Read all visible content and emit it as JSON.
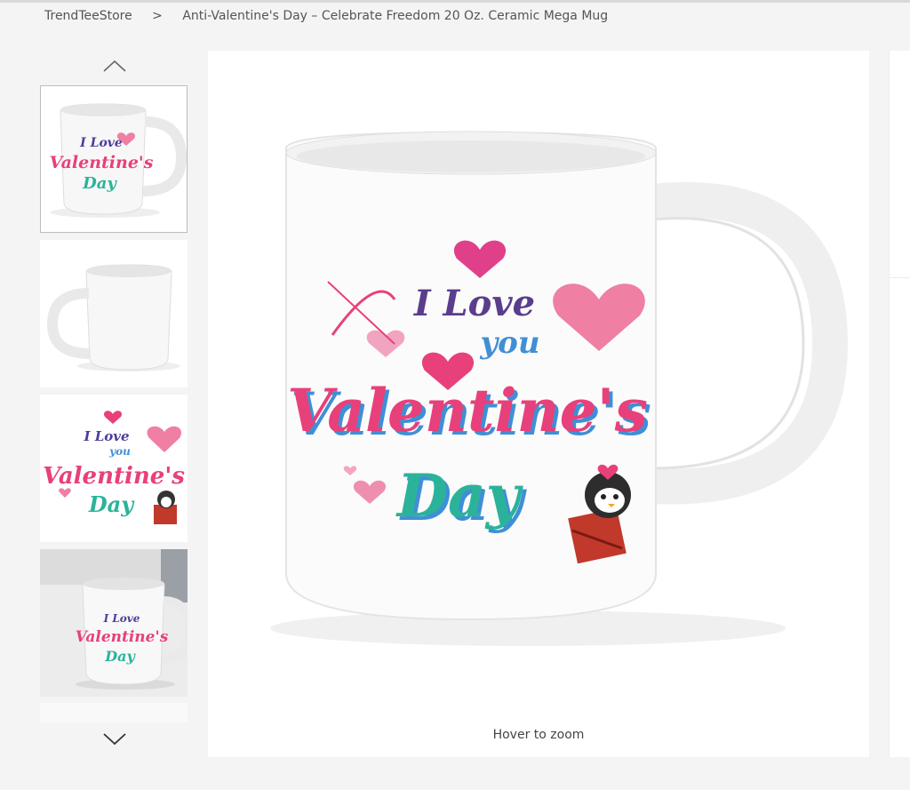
{
  "breadcrumb": {
    "store": "TrendTeeStore",
    "separator": ">",
    "product": "Anti-Valentine's Day – Celebrate Freedom 20 Oz. Ceramic Mega Mug"
  },
  "gallery": {
    "zoom_hint": "Hover to zoom",
    "design_text": {
      "line1": "I Love",
      "line2": "you",
      "line3": "Valentine's",
      "line4": "Day"
    }
  },
  "icons": {
    "prev": "chevron-up-icon",
    "next": "chevron-down-icon"
  },
  "colors": {
    "pink": "#e8407a",
    "teal": "#2bb39a",
    "blue": "#3f8fd6",
    "purple": "#5a3d8c"
  }
}
